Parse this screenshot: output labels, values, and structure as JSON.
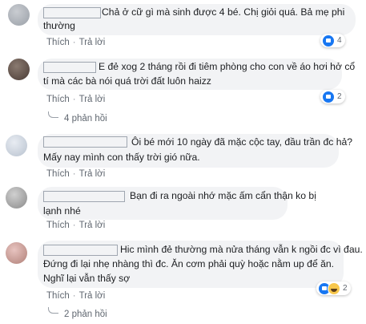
{
  "comments": [
    {
      "lines": [
        "Chả ở cữ gì mà sinh được 4 bé. Chị giỏi quá. Bả mẹ phi",
        "thường"
      ],
      "actions": {
        "like": "Thích",
        "reply": "Trả lời"
      },
      "reaction_count": "4",
      "reactions": [
        "like-icon"
      ]
    },
    {
      "lines": [
        "E đẻ xog 2 tháng rồi đi tiêm phòng cho con về áo hơi hở cổ",
        "tí mà các bà nói quá trời đất luôn haizz"
      ],
      "actions": {
        "like": "Thích",
        "reply": "Trả lời"
      },
      "reaction_count": "2",
      "reactions": [
        "like-icon"
      ],
      "replies_label": "4 phản hồi"
    },
    {
      "lines": [
        "Ôi bé mới 10 ngày đã mặc cộc tay, đầu trần đc hả?",
        "Mấy nay mình con thấy trời gió nữa."
      ],
      "actions": {
        "like": "Thích",
        "reply": "Trả lời"
      }
    },
    {
      "lines": [
        "Bạn đi ra ngoài nhớ mặc ấm cẩn thận ko bị",
        "lạnh nhé"
      ],
      "actions": {
        "like": "Thích",
        "reply": "Trả lời"
      }
    },
    {
      "lines": [
        "Hic mình đẻ thường mà nửa tháng vẫn k ngồi đc vì đau.",
        "Đứng đi lại nhẹ nhàng thì đc. Ăn cơm phải quỳ hoặc nằm up để ăn.",
        "Nghĩ lại vẫn thấy sợ"
      ],
      "actions": {
        "like": "Thích",
        "reply": "Trả lời"
      },
      "reaction_count": "2",
      "reactions": [
        "like-icon",
        "haha-icon"
      ],
      "replies_label": "2 phản hồi"
    }
  ],
  "dot": "·",
  "colors": {
    "bubble": "#f2f3f5",
    "meta": "#606770",
    "like": "#1877f2"
  }
}
